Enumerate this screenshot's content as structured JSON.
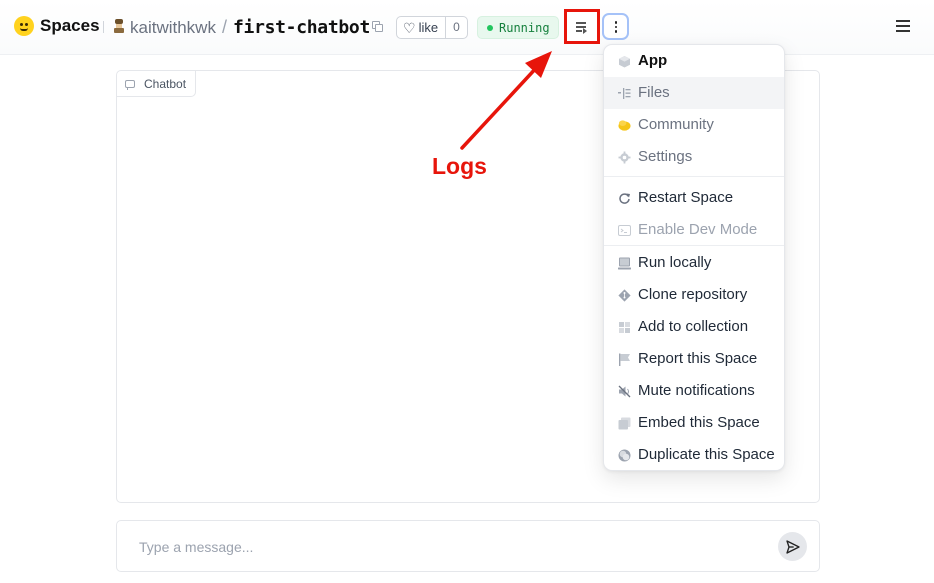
{
  "header": {
    "brand": "Spaces",
    "owner": "kaitwithkwk",
    "separator": "/",
    "repo": "first-chatbot",
    "like_label": "like",
    "like_count": "0",
    "status": "Running",
    "status_color": "#22c55e"
  },
  "annotation": {
    "label": "Logs",
    "color": "#e7150b"
  },
  "chat": {
    "label": "Chatbot",
    "placeholder": "Type a message..."
  },
  "menu": {
    "items": [
      {
        "label": "App",
        "icon": "cube-icon"
      },
      {
        "label": "Files",
        "icon": "files-icon"
      },
      {
        "label": "Community",
        "icon": "community-icon"
      },
      {
        "label": "Settings",
        "icon": "gear-icon"
      },
      {
        "label": "Restart Space",
        "icon": "restart-icon"
      },
      {
        "label": "Enable Dev Mode",
        "icon": "terminal-icon"
      },
      {
        "label": "Run locally",
        "icon": "computer-icon"
      },
      {
        "label": "Clone repository",
        "icon": "git-icon"
      },
      {
        "label": "Add to collection",
        "icon": "collection-icon"
      },
      {
        "label": "Report this Space",
        "icon": "flag-icon"
      },
      {
        "label": "Mute notifications",
        "icon": "mute-icon"
      },
      {
        "label": "Embed this Space",
        "icon": "embed-icon"
      },
      {
        "label": "Duplicate this Space",
        "icon": "duplicate-icon"
      }
    ]
  }
}
